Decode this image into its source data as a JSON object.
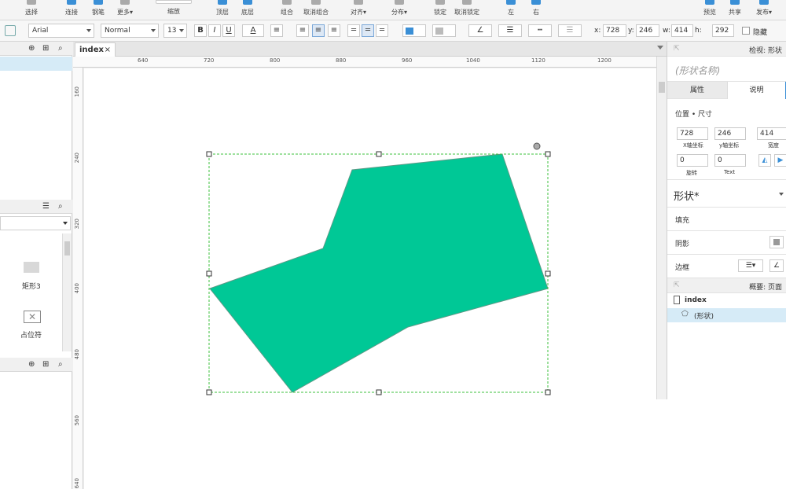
{
  "toolbar": {
    "buttons": [
      {
        "label": "选择"
      },
      {
        "label": "连接"
      },
      {
        "label": "钢笔"
      },
      {
        "label": "更多▾"
      },
      {
        "label": "缩放"
      },
      {
        "label": "顶层"
      },
      {
        "label": "底层"
      },
      {
        "label": "组合"
      },
      {
        "label": "取消组合"
      },
      {
        "label": "对齐▾"
      },
      {
        "label": "分布▾"
      },
      {
        "label": "锁定"
      },
      {
        "label": "取消锁定"
      },
      {
        "label": "左"
      },
      {
        "label": "右"
      },
      {
        "label": "预览"
      },
      {
        "label": "共享"
      },
      {
        "label": "发布▾"
      }
    ]
  },
  "format": {
    "font_family": "Arial",
    "font_style": "Normal",
    "font_size": "13",
    "bold": "B",
    "italic": "I",
    "underline": "U",
    "font_color": "A",
    "x_label": "x:",
    "x_value": "728",
    "y_label": "y:",
    "y_value": "246",
    "w_label": "w:",
    "w_value": "414",
    "h_label": "h:",
    "h_value": "292",
    "hidden_label": "隐藏"
  },
  "tab": {
    "label": "index",
    "close": "×"
  },
  "rulers": {
    "h_ticks": [
      "640",
      "720",
      "800",
      "880",
      "960",
      "1040",
      "1120",
      "1200"
    ],
    "v_ticks": [
      "160",
      "240",
      "320",
      "400",
      "480",
      "560",
      "640"
    ]
  },
  "left": {
    "widgets": [
      {
        "label": "矩形3"
      },
      {
        "label": "占位符"
      }
    ]
  },
  "inspector": {
    "title": "检视: 形状",
    "shape_name_placeholder": "(形状名称)",
    "tab_props": "属性",
    "tab_notes": "说明",
    "section_pos": "位置 • 尺寸",
    "x_val": "728",
    "x_cap": "X轴坐标",
    "y_val": "246",
    "y_cap": "y轴坐标",
    "w_val": "414",
    "w_cap": "宽度",
    "rot_val": "0",
    "rot_cap": "旋转",
    "text_val": "0",
    "text_cap": "Text",
    "shape_label": "形状*",
    "fill_label": "填充",
    "shadow_label": "阴影",
    "border_label": "边框",
    "outline_title": "概要: 页面",
    "outline_page": "index",
    "outline_item": "(形状)"
  },
  "colors": {
    "shape_fill": "#00c896",
    "selection": "#3cc03c",
    "accent": "#3a8fd6"
  }
}
